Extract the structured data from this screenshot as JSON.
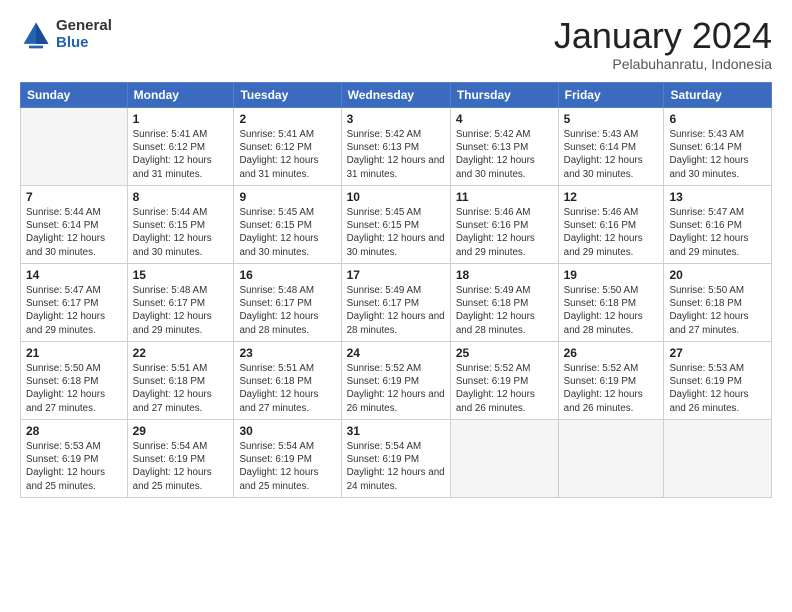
{
  "logo": {
    "general": "General",
    "blue": "Blue"
  },
  "header": {
    "month": "January 2024",
    "location": "Pelabuhanratu, Indonesia"
  },
  "weekdays": [
    "Sunday",
    "Monday",
    "Tuesday",
    "Wednesday",
    "Thursday",
    "Friday",
    "Saturday"
  ],
  "weeks": [
    [
      {
        "day": null
      },
      {
        "day": "1",
        "sunrise": "Sunrise: 5:41 AM",
        "sunset": "Sunset: 6:12 PM",
        "daylight": "Daylight: 12 hours and 31 minutes."
      },
      {
        "day": "2",
        "sunrise": "Sunrise: 5:41 AM",
        "sunset": "Sunset: 6:12 PM",
        "daylight": "Daylight: 12 hours and 31 minutes."
      },
      {
        "day": "3",
        "sunrise": "Sunrise: 5:42 AM",
        "sunset": "Sunset: 6:13 PM",
        "daylight": "Daylight: 12 hours and 31 minutes."
      },
      {
        "day": "4",
        "sunrise": "Sunrise: 5:42 AM",
        "sunset": "Sunset: 6:13 PM",
        "daylight": "Daylight: 12 hours and 30 minutes."
      },
      {
        "day": "5",
        "sunrise": "Sunrise: 5:43 AM",
        "sunset": "Sunset: 6:14 PM",
        "daylight": "Daylight: 12 hours and 30 minutes."
      },
      {
        "day": "6",
        "sunrise": "Sunrise: 5:43 AM",
        "sunset": "Sunset: 6:14 PM",
        "daylight": "Daylight: 12 hours and 30 minutes."
      }
    ],
    [
      {
        "day": "7",
        "sunrise": "Sunrise: 5:44 AM",
        "sunset": "Sunset: 6:14 PM",
        "daylight": "Daylight: 12 hours and 30 minutes."
      },
      {
        "day": "8",
        "sunrise": "Sunrise: 5:44 AM",
        "sunset": "Sunset: 6:15 PM",
        "daylight": "Daylight: 12 hours and 30 minutes."
      },
      {
        "day": "9",
        "sunrise": "Sunrise: 5:45 AM",
        "sunset": "Sunset: 6:15 PM",
        "daylight": "Daylight: 12 hours and 30 minutes."
      },
      {
        "day": "10",
        "sunrise": "Sunrise: 5:45 AM",
        "sunset": "Sunset: 6:15 PM",
        "daylight": "Daylight: 12 hours and 30 minutes."
      },
      {
        "day": "11",
        "sunrise": "Sunrise: 5:46 AM",
        "sunset": "Sunset: 6:16 PM",
        "daylight": "Daylight: 12 hours and 29 minutes."
      },
      {
        "day": "12",
        "sunrise": "Sunrise: 5:46 AM",
        "sunset": "Sunset: 6:16 PM",
        "daylight": "Daylight: 12 hours and 29 minutes."
      },
      {
        "day": "13",
        "sunrise": "Sunrise: 5:47 AM",
        "sunset": "Sunset: 6:16 PM",
        "daylight": "Daylight: 12 hours and 29 minutes."
      }
    ],
    [
      {
        "day": "14",
        "sunrise": "Sunrise: 5:47 AM",
        "sunset": "Sunset: 6:17 PM",
        "daylight": "Daylight: 12 hours and 29 minutes."
      },
      {
        "day": "15",
        "sunrise": "Sunrise: 5:48 AM",
        "sunset": "Sunset: 6:17 PM",
        "daylight": "Daylight: 12 hours and 29 minutes."
      },
      {
        "day": "16",
        "sunrise": "Sunrise: 5:48 AM",
        "sunset": "Sunset: 6:17 PM",
        "daylight": "Daylight: 12 hours and 28 minutes."
      },
      {
        "day": "17",
        "sunrise": "Sunrise: 5:49 AM",
        "sunset": "Sunset: 6:17 PM",
        "daylight": "Daylight: 12 hours and 28 minutes."
      },
      {
        "day": "18",
        "sunrise": "Sunrise: 5:49 AM",
        "sunset": "Sunset: 6:18 PM",
        "daylight": "Daylight: 12 hours and 28 minutes."
      },
      {
        "day": "19",
        "sunrise": "Sunrise: 5:50 AM",
        "sunset": "Sunset: 6:18 PM",
        "daylight": "Daylight: 12 hours and 28 minutes."
      },
      {
        "day": "20",
        "sunrise": "Sunrise: 5:50 AM",
        "sunset": "Sunset: 6:18 PM",
        "daylight": "Daylight: 12 hours and 27 minutes."
      }
    ],
    [
      {
        "day": "21",
        "sunrise": "Sunrise: 5:50 AM",
        "sunset": "Sunset: 6:18 PM",
        "daylight": "Daylight: 12 hours and 27 minutes."
      },
      {
        "day": "22",
        "sunrise": "Sunrise: 5:51 AM",
        "sunset": "Sunset: 6:18 PM",
        "daylight": "Daylight: 12 hours and 27 minutes."
      },
      {
        "day": "23",
        "sunrise": "Sunrise: 5:51 AM",
        "sunset": "Sunset: 6:18 PM",
        "daylight": "Daylight: 12 hours and 27 minutes."
      },
      {
        "day": "24",
        "sunrise": "Sunrise: 5:52 AM",
        "sunset": "Sunset: 6:19 PM",
        "daylight": "Daylight: 12 hours and 26 minutes."
      },
      {
        "day": "25",
        "sunrise": "Sunrise: 5:52 AM",
        "sunset": "Sunset: 6:19 PM",
        "daylight": "Daylight: 12 hours and 26 minutes."
      },
      {
        "day": "26",
        "sunrise": "Sunrise: 5:52 AM",
        "sunset": "Sunset: 6:19 PM",
        "daylight": "Daylight: 12 hours and 26 minutes."
      },
      {
        "day": "27",
        "sunrise": "Sunrise: 5:53 AM",
        "sunset": "Sunset: 6:19 PM",
        "daylight": "Daylight: 12 hours and 26 minutes."
      }
    ],
    [
      {
        "day": "28",
        "sunrise": "Sunrise: 5:53 AM",
        "sunset": "Sunset: 6:19 PM",
        "daylight": "Daylight: 12 hours and 25 minutes."
      },
      {
        "day": "29",
        "sunrise": "Sunrise: 5:54 AM",
        "sunset": "Sunset: 6:19 PM",
        "daylight": "Daylight: 12 hours and 25 minutes."
      },
      {
        "day": "30",
        "sunrise": "Sunrise: 5:54 AM",
        "sunset": "Sunset: 6:19 PM",
        "daylight": "Daylight: 12 hours and 25 minutes."
      },
      {
        "day": "31",
        "sunrise": "Sunrise: 5:54 AM",
        "sunset": "Sunset: 6:19 PM",
        "daylight": "Daylight: 12 hours and 24 minutes."
      },
      {
        "day": null
      },
      {
        "day": null
      },
      {
        "day": null
      }
    ]
  ]
}
